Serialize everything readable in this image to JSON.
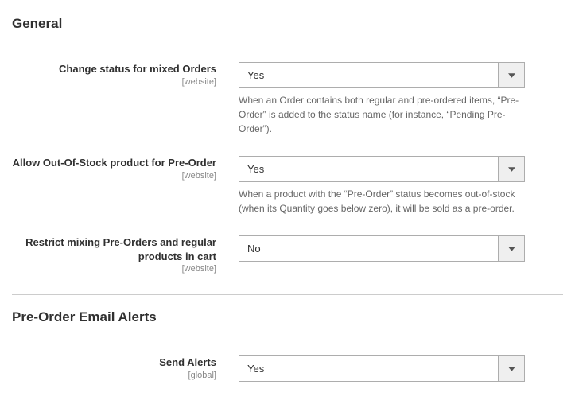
{
  "sections": [
    {
      "title": "General",
      "fields": [
        {
          "label": "Change status for mixed Orders",
          "scope": "[website]",
          "value": "Yes",
          "note": "When an Order contains both regular and pre-ordered items, “Pre-Order” is added to the status name (for instance, “Pending Pre-Order”)."
        },
        {
          "label": "Allow Out-Of-Stock product for Pre-Order",
          "scope": "[website]",
          "value": "Yes",
          "note": "When a product with the “Pre-Order” status becomes out-of-stock (when its Quantity goes below zero), it will be sold as a pre-order."
        },
        {
          "label": "Restrict mixing Pre-Orders and regular products in cart",
          "scope": "[website]",
          "value": "No",
          "note": ""
        }
      ]
    },
    {
      "title": "Pre-Order Email Alerts",
      "fields": [
        {
          "label": "Send Alerts",
          "scope": "[global]",
          "value": "Yes",
          "note": ""
        }
      ]
    }
  ]
}
